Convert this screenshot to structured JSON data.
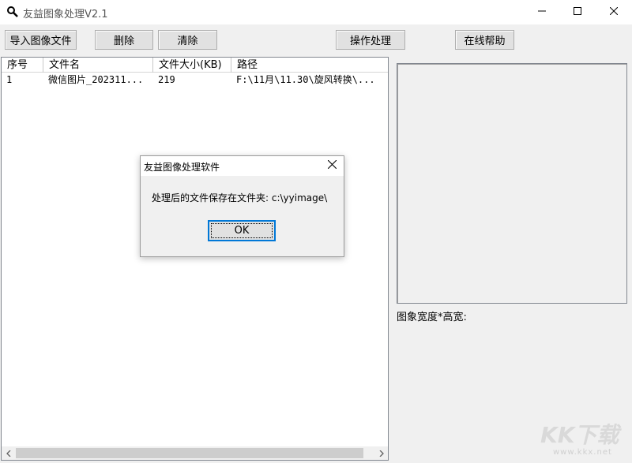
{
  "window": {
    "title": "友益图象处理V2.1",
    "icons": {
      "app": "magnifier-icon",
      "minimize": "minimize-icon",
      "maximize": "maximize-icon",
      "close": "close-icon"
    }
  },
  "toolbar": {
    "import_label": "导入图像文件",
    "delete_label": "删除",
    "clear_label": "清除",
    "process_label": "操作处理",
    "help_label": "在线帮助"
  },
  "file_list": {
    "columns": [
      "序号",
      "文件名",
      "文件大小(KB)",
      "路径"
    ],
    "rows": [
      {
        "seq": "1",
        "name": "微信图片_202311...",
        "size": "219",
        "path": "F:\\11月\\11.30\\旋风转换\\..."
      }
    ]
  },
  "preview": {
    "dimension_label": "图象宽度*高宽:"
  },
  "dialog": {
    "title": "友益图像处理软件",
    "message": "处理后的文件保存在文件夹: c:\\yyimage\\",
    "ok_label": "OK"
  },
  "watermark": {
    "logo": "KK下载",
    "url": "www.kkx.net"
  },
  "colors": {
    "accent": "#0078d7",
    "window_bg": "#f0f0f0",
    "button_face": "#e1e1e1"
  }
}
